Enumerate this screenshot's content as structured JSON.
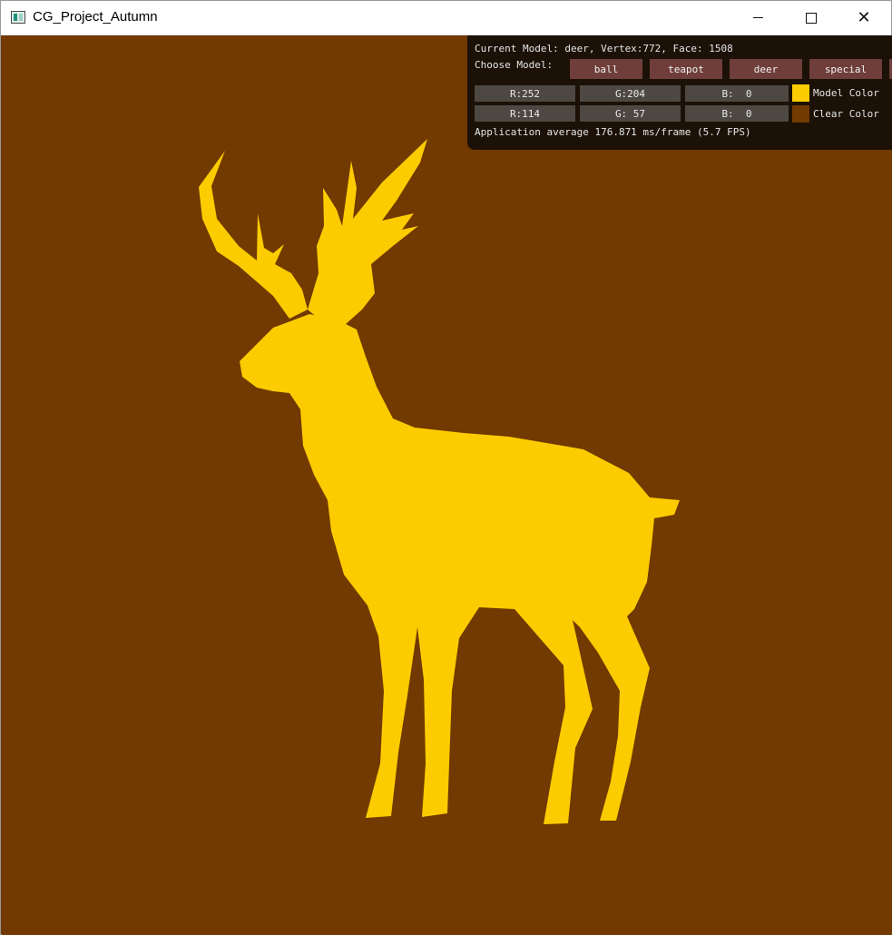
{
  "window": {
    "title": "CG_Project_Autumn",
    "controls": {
      "minimize": "minimize",
      "maximize": "maximize",
      "close": "close"
    }
  },
  "scene": {
    "background_color": "#723900",
    "model_color": "#fccc00",
    "model": "deer"
  },
  "panel": {
    "info_line": "Current Model: deer, Vertex:772, Face: 1508",
    "choose_label": "Choose Model:",
    "model_buttons": [
      "ball",
      "teapot",
      "deer",
      "special"
    ],
    "model_color": {
      "r": "R:252",
      "g": "G:204",
      "b": "B:  0",
      "label": "Model Color",
      "swatch": "#fccc00"
    },
    "clear_color": {
      "r": "R:114",
      "g": "G: 57",
      "b": "B:  0",
      "label": "Clear Color",
      "swatch": "#723900"
    },
    "fps_line": "Application average 176.871 ms/frame (5.7 FPS)"
  },
  "icons": {
    "app": "app-window-icon",
    "minimize": "minimize-icon",
    "maximize": "maximize-icon",
    "close": "close-icon"
  }
}
